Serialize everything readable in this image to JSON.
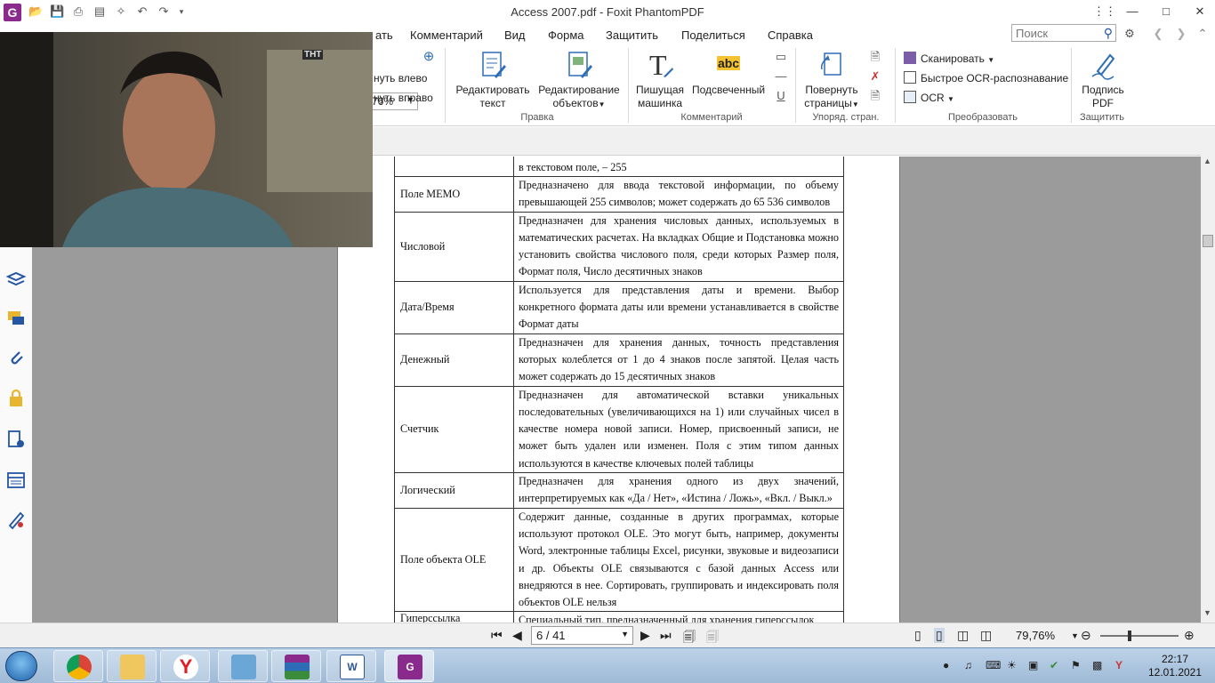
{
  "window": {
    "title": "Access 2007.pdf - Foxit PhantomPDF",
    "app_icon": "G"
  },
  "menu": {
    "tabs": [
      "Комментарий",
      "Вид",
      "Форма",
      "Защитить",
      "Поделиться",
      "Справка"
    ],
    "partial_tab": "ать",
    "search_placeholder": "Поиск"
  },
  "ribbon": {
    "zoom_value": "76%",
    "rotate_left": "нуть влево",
    "rotate_right": "нуть вправо",
    "edit_text": [
      "Редактировать",
      "текст"
    ],
    "edit_objects": [
      "Редактирование",
      "объектов"
    ],
    "group_edit": "Правка",
    "typewriter": [
      "Пишущая",
      "машинка"
    ],
    "highlighter": "Подсвеченный",
    "group_comment": "Комментарий",
    "rotate_pages": [
      "Повернуть",
      "страницы"
    ],
    "group_pages": "Упоряд. стран.",
    "scan": "Сканировать",
    "quick_ocr": "Быстрое OCR-распознавание",
    "ocr": "OCR",
    "group_convert": "Преобразовать",
    "sign_pdf": [
      "Подпись",
      "PDF"
    ],
    "group_protect": "Защитить",
    "abc_label": "abc"
  },
  "document": {
    "rows": [
      {
        "name": "",
        "desc": "в текстовом поле, – 255"
      },
      {
        "name": "Поле МЕМО",
        "desc": "Предназначено для ввода текстовой информации, по объему превышающей 255 символов; может содержать до 65 536 символов"
      },
      {
        "name": "Числовой",
        "desc": "Предназначен для хранения числовых данных, используемых в математических расчетах. На вкладках Общие и Подстановка можно установить свойства числового поля, среди которых Размер поля, Формат поля, Число десятичных знаков"
      },
      {
        "name": "Дата/Время",
        "desc": "Используется для представления даты и времени. Выбор конкретного формата даты или времени устанавливается в свойстве Формат даты"
      },
      {
        "name": "Денежный",
        "desc": "Предназначен для хранения данных, точность представления которых колеблется от 1 до 4 знаков после запятой. Целая часть может содержать до 15 десятичных знаков"
      },
      {
        "name": "Счетчик",
        "desc": "Предназначен для автоматической вставки уникальных последовательных (увеличивающихся на 1) или случайных чисел в качестве номера новой записи. Номер, присвоенный записи, не может быть удален или изменен. Поля с этим типом данных используются в качестве ключевых полей таблицы"
      },
      {
        "name": "Логический",
        "desc": "Предназначен для хранения одного из двух значений, интерпретируемых как «Да / Нет», «Истина / Ложь», «Вкл. / Выкл.»"
      },
      {
        "name": "Поле объекта OLE",
        "desc": "Содержит данные, созданные в других программах, которые используют протокол OLE. Это могут быть, например, документы Word, электронные таблицы Excel, рисунки, звуковые и видеозаписи и др. Объекты OLE связываются с базой данных Access или внедряются в нее. Сортировать, группировать и индексировать поля объектов OLE нельзя"
      },
      {
        "name": "Гиперссылка",
        "desc": "Специальный тип, предназначенный для хранения гиперссылок"
      }
    ]
  },
  "video": {
    "channel_logo": "ТНТ"
  },
  "statusbar": {
    "page_indicator": "6 / 41",
    "zoom": "79,76%"
  },
  "taskbar": {
    "clock_time": "22:17",
    "clock_date": "12.01.2021"
  }
}
